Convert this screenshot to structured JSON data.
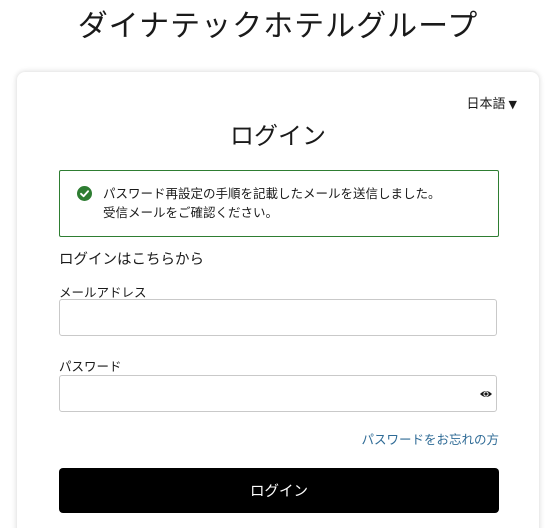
{
  "brand": {
    "title": "ダイナテックホテルグループ"
  },
  "language": {
    "selected": "日本語",
    "caret": "▼"
  },
  "login": {
    "heading": "ログイン",
    "subheading": "ログインはこちらから",
    "button_label": "ログイン",
    "forgot_password": "パスワードをお忘れの方"
  },
  "alert": {
    "line1": "パスワード再設定の手順を記載したメールを送信しました。",
    "line2": "受信メールをご確認ください。",
    "icon": "check-circle-icon",
    "color": "#2e7d32"
  },
  "fields": {
    "email_label": "メールアドレス",
    "email_value": "",
    "password_label": "パスワード",
    "password_value": ""
  },
  "colors": {
    "button": "#000000",
    "link": "#2f6b96",
    "success": "#2e7d32"
  }
}
